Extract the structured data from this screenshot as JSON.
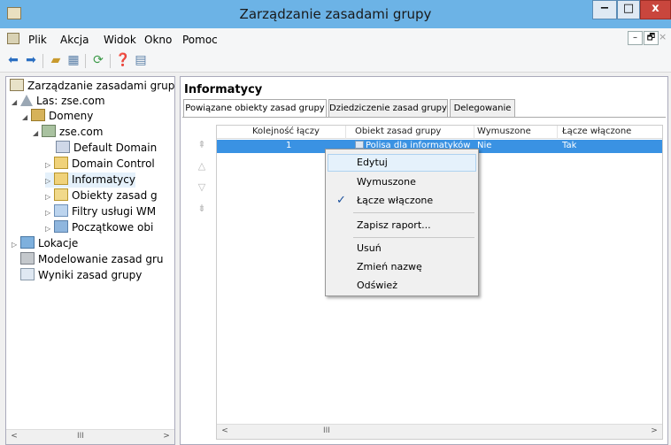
{
  "window": {
    "title": "Zarządzanie zasadami grupy",
    "minimize": "−",
    "maximize": "□",
    "close": "x"
  },
  "menu": {
    "items": [
      "Plik",
      "Akcja",
      "Widok",
      "Okno",
      "Pomoc"
    ],
    "mdi_minimize": "–",
    "mdi_restore": "🗗",
    "mdi_close": "×"
  },
  "tree": {
    "root": "Zarządzanie zasadami grupy",
    "forest": "Las: zse.com",
    "domains": "Domeny",
    "domain": "zse.com",
    "children": [
      "Default Domain",
      "Domain Control",
      "Informatycy",
      "Obiekty zasad g",
      "Filtry usługi WM",
      "Początkowe obi"
    ],
    "sites": "Lokacje",
    "modeling": "Modelowanie zasad gru",
    "results": "Wyniki zasad grupy",
    "scroll_thumb": "III"
  },
  "pane": {
    "title": "Informatycy",
    "tabs": [
      "Powiązane obiekty zasad grupy",
      "Dziedziczenie zasad grupy",
      "Delegowanie"
    ]
  },
  "grid": {
    "columns": [
      "Kolejność łączy",
      "Obiekt zasad grupy",
      "Wymuszone",
      "Łącze włączone"
    ],
    "row": {
      "order": "1",
      "gpo": "Polisa dla informatyków",
      "enforced": "Nie",
      "enabled": "Tak"
    },
    "scroll_thumb": "III"
  },
  "context_menu": {
    "items": [
      "Edytuj",
      "Wymuszone",
      "Łącze włączone",
      "Zapisz raport...",
      "Usuń",
      "Zmień nazwę",
      "Odśwież"
    ],
    "checked_item": "Łącze włączone",
    "check_glyph": "✓"
  }
}
